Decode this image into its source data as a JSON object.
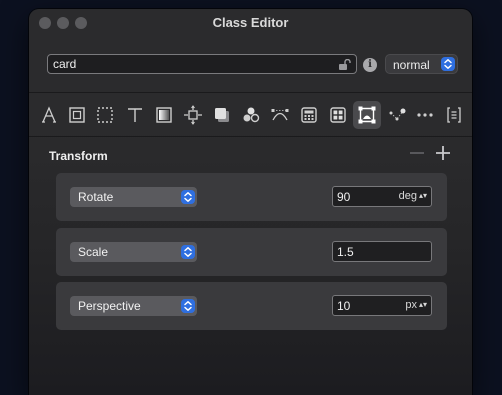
{
  "window": {
    "title": "Class Editor"
  },
  "header": {
    "class_name": "card",
    "state_selected": "normal"
  },
  "toolbar": {
    "tools": [
      {
        "icon": "typography-a-icon"
      },
      {
        "icon": "box-frame-icon"
      },
      {
        "icon": "dashed-border-icon"
      },
      {
        "icon": "text-t-icon"
      },
      {
        "icon": "background-gradient-icon"
      },
      {
        "icon": "spacing-icon"
      },
      {
        "icon": "shadow-icon"
      },
      {
        "icon": "circles-effects-icon"
      },
      {
        "icon": "path-curve-icon"
      },
      {
        "icon": "calculator-icon"
      },
      {
        "icon": "grid-layout-icon"
      },
      {
        "icon": "transform-icon",
        "active": true
      },
      {
        "icon": "node-dots-icon"
      },
      {
        "icon": "more-ellipsis-icon"
      },
      {
        "icon": "code-brackets-icon"
      }
    ]
  },
  "section": {
    "title": "Transform"
  },
  "rows": [
    {
      "property": "Rotate",
      "value": "90",
      "unit": "deg"
    },
    {
      "property": "Scale",
      "value": "1.5",
      "unit": ""
    },
    {
      "property": "Perspective",
      "value": "10",
      "unit": "px"
    }
  ],
  "colors": {
    "accent": "#2f6fe0",
    "panel": "#2b2b2d",
    "row": "#3a3a3d",
    "desktop": "#0c1120"
  }
}
